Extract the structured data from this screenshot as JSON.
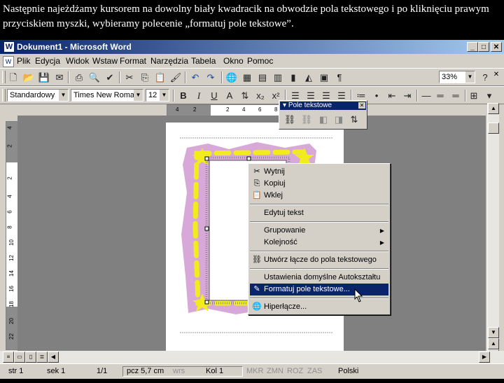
{
  "caption": "Następnie najeżdżamy kursorem na dowolny biały kwadracik na obwodzie pola tekstowego i po kliknięciu prawym przyciskiem myszki, wybieramy polecenie „formatuj pole tekstowe”.",
  "window": {
    "title": "Dokument1 - Microsoft Word",
    "title_icon": "word-icon"
  },
  "menu": [
    "Plik",
    "Edycja",
    "Widok",
    "Wstaw",
    "Format",
    "Narzędzia",
    "Tabela",
    "Okno",
    "Pomoc"
  ],
  "formatting": {
    "style": "Standardowy",
    "font": "Times New Roman",
    "size": "12",
    "bold": "B",
    "italic": "I",
    "underline": "U"
  },
  "standard": {
    "zoom": "33%",
    "pilcrow": "¶"
  },
  "ruler_h": [
    "4",
    "2",
    "2",
    "4",
    "6",
    "8"
  ],
  "ruler_v": [
    "4",
    "2",
    "2",
    "4",
    "6",
    "8",
    "10",
    "12",
    "14",
    "16",
    "18",
    "20",
    "22"
  ],
  "floating_toolbar": {
    "title": "Pole tekstowe"
  },
  "context_menu": [
    {
      "label": "Wytnij",
      "icon": "scissors-icon",
      "glyph": "✂"
    },
    {
      "label": "Kopiuj",
      "icon": "copy-icon",
      "glyph": "⎘"
    },
    {
      "label": "Wklej",
      "icon": "paste-icon",
      "glyph": "📋"
    },
    {
      "label": "Edytuj tekst"
    },
    {
      "label": "Grupowanie",
      "submenu": "▶"
    },
    {
      "label": "Kolejność",
      "submenu": "▶"
    },
    {
      "label": "Utwórz łącze do pola tekstowego",
      "icon": "link-icon",
      "glyph": "⛓"
    },
    {
      "label": "Ustawienia domyślne Autokształtu"
    },
    {
      "label": "Formatuj pole tekstowe...",
      "icon": "format-icon",
      "glyph": "✎"
    },
    {
      "label": "Hiperłącze...",
      "icon": "globe-icon",
      "glyph": "🌐"
    }
  ],
  "status": {
    "page": "str 1",
    "section": "sek 1",
    "pages": "1/1",
    "position": "pcz 5,7 cm",
    "line": "wrs",
    "col": "Kol 1",
    "rec": "MKR",
    "trk": "ZMN",
    "ext": "ROZ",
    "ovr": "ZAS",
    "lang": "Polski"
  },
  "colors": {
    "frame_fill": "#d8a8d8",
    "frame_dash": "#f2ec1e",
    "selection": "#0a246a",
    "chrome": "#d4d0c8"
  }
}
